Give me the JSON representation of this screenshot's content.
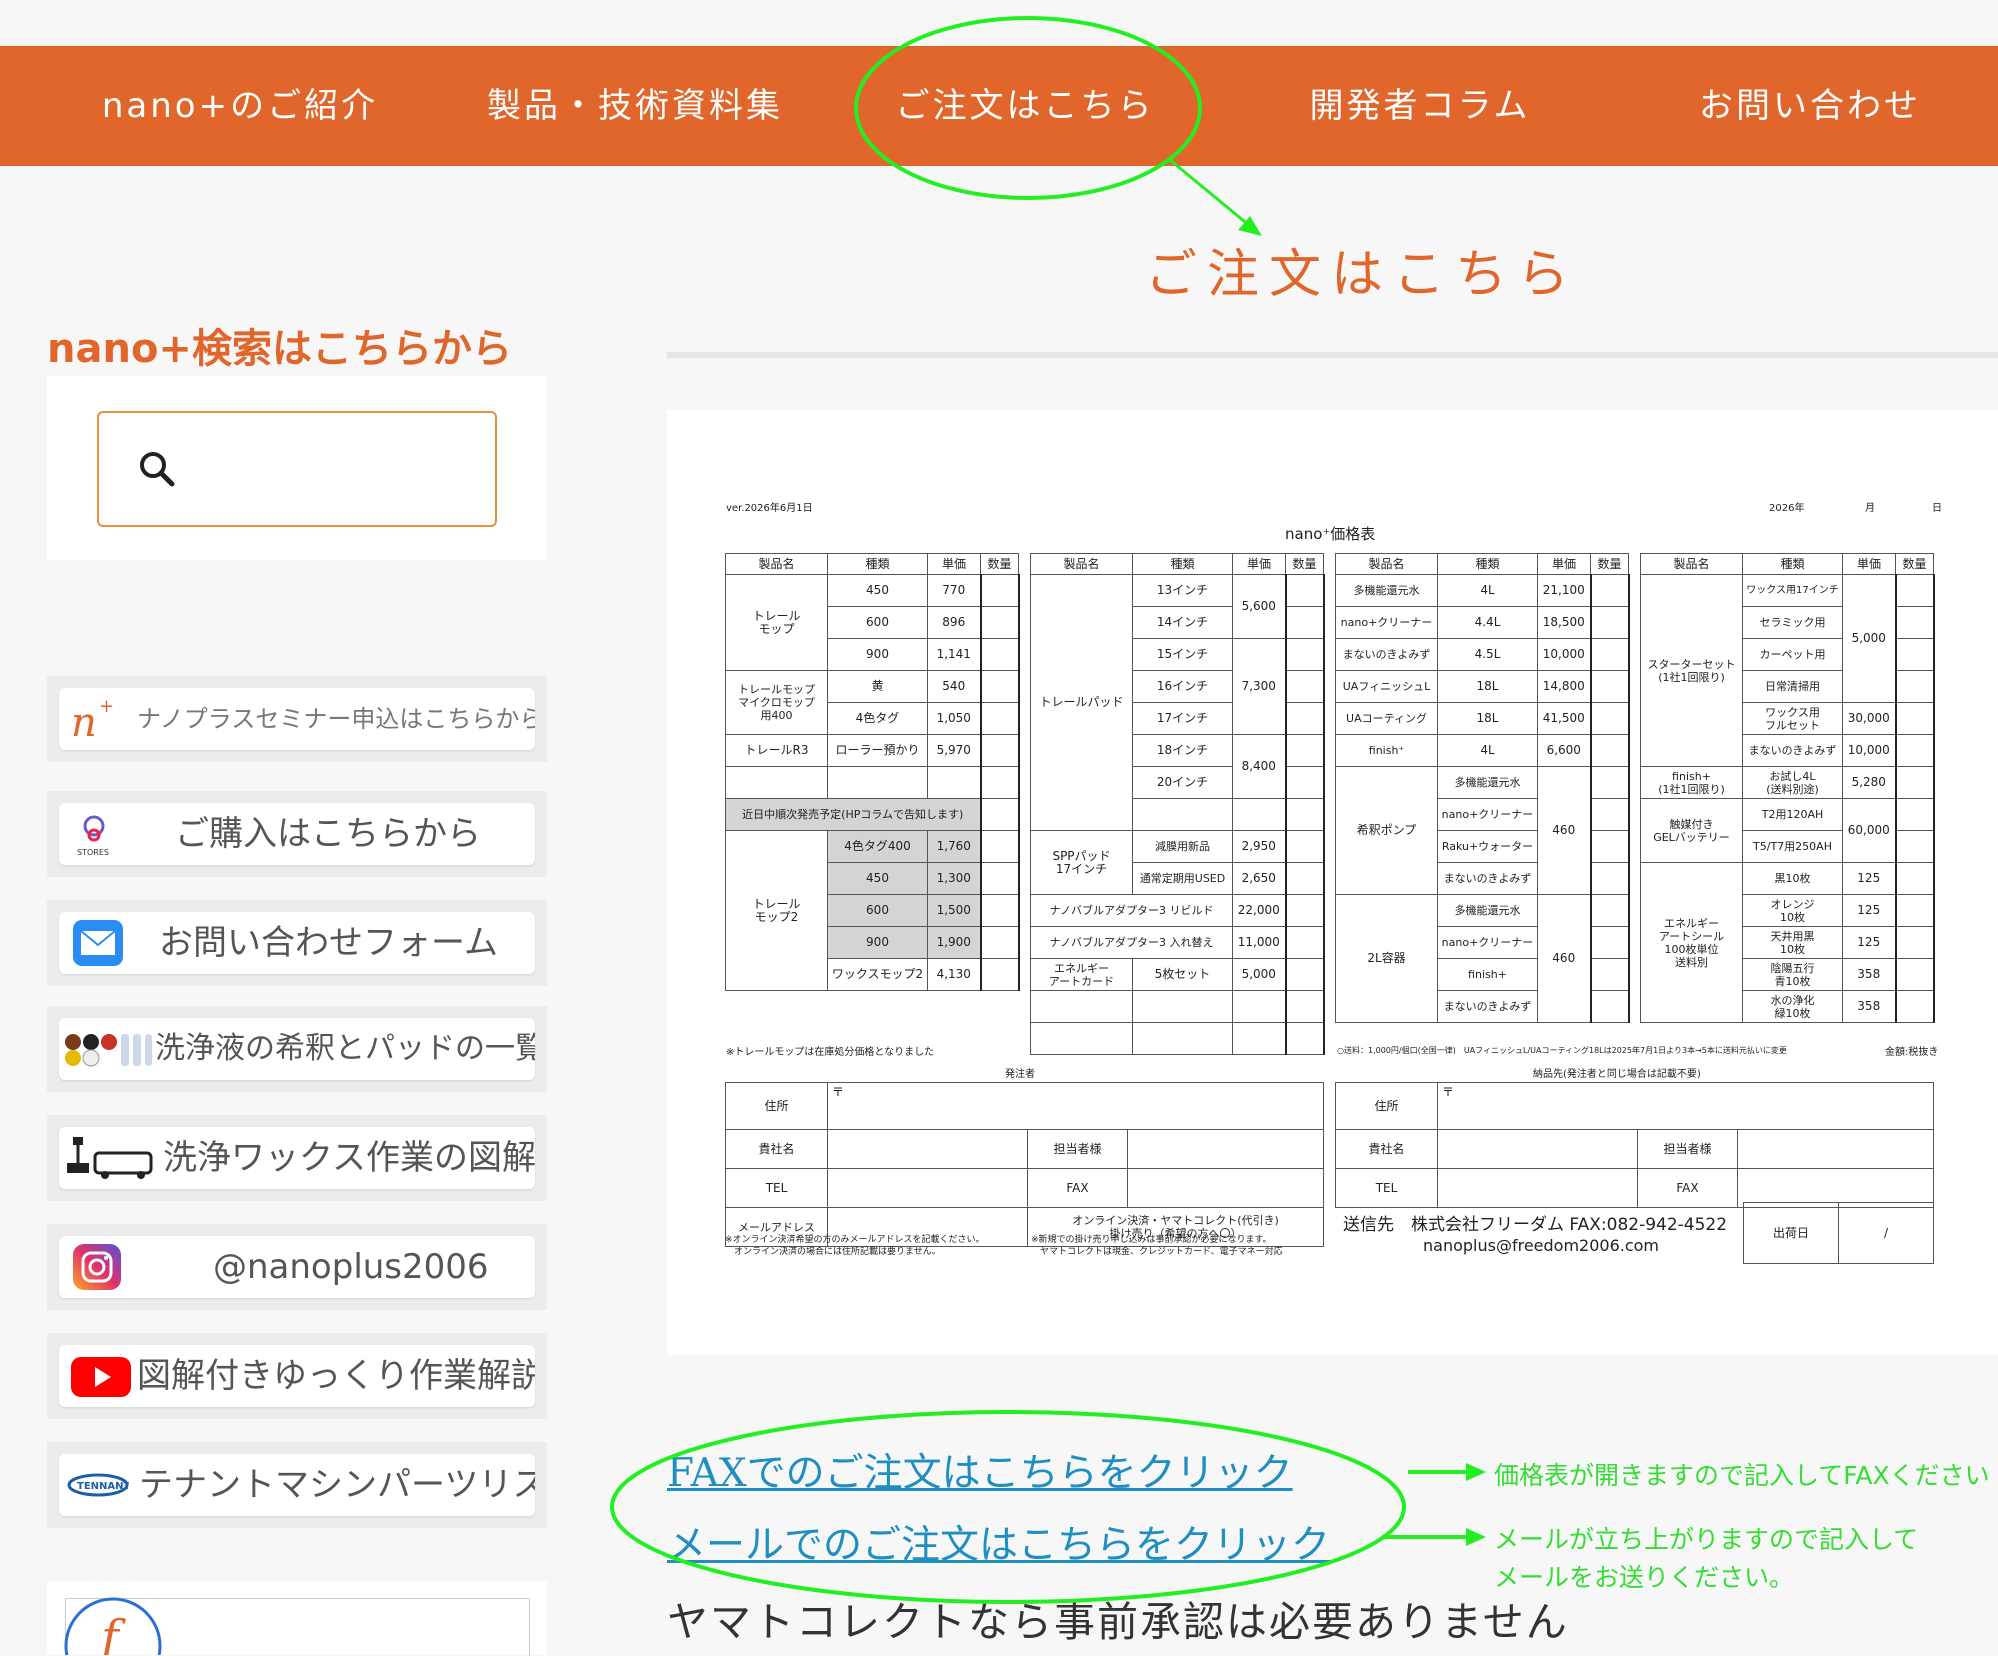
{
  "nav": [
    "nano+のご紹介",
    "製品・技術資料集",
    "ご注文はこちら",
    "開発者コラム",
    "お問い合わせ"
  ],
  "page_heading": "ご注文はこちら",
  "sidebar": {
    "search_title": "nano+検索はこちらから",
    "banners": [
      {
        "label": "ナノプラスセミナー申込はこちらから",
        "icon": "nanoplus-logo-icon"
      },
      {
        "label": "ご購入はこちらから",
        "icon": "stores-icon",
        "icon_caption": "STORES"
      },
      {
        "label": "お問い合わせフォーム",
        "icon": "mail-icon"
      },
      {
        "label": "洗浄液の希釈とパッドの一覧",
        "icon": "pads-bottles-icon"
      },
      {
        "label": "洗浄ワックス作業の図解",
        "icon": "floor-machine-icon"
      },
      {
        "label": "@nanoplus2006",
        "icon": "instagram-icon"
      },
      {
        "label": "図解付きゆっくり作業解説",
        "icon": "youtube-icon"
      },
      {
        "label": "テナントマシンパーツリスト",
        "icon": "tennant-icon",
        "icon_caption": "TENNANT"
      }
    ]
  },
  "sheet": {
    "version": "ver.2026年6月1日",
    "date_year": "2026年",
    "date_month": "月",
    "date_day": "日",
    "title": "nano⁺価格表",
    "headers": [
      "製品名",
      "種類",
      "単価",
      "数量"
    ],
    "t1": {
      "trail_mop": "トレール\nモップ",
      "rows_a": [
        [
          "450",
          "770"
        ],
        [
          "600",
          "896"
        ],
        [
          "900",
          "1,141"
        ]
      ],
      "micro": "トレールモップ\nマイクロモップ\n用400",
      "micro_rows": [
        [
          "黄",
          "540"
        ],
        [
          "4色タグ",
          "1,050"
        ]
      ],
      "r3": [
        "トレールR3",
        "ローラー預かり",
        "5,970"
      ],
      "notice": "近日中順次発売予定(HPコラムで告知します)",
      "mop2": "トレール\nモップ2",
      "mop2_rows": [
        [
          "4色タグ400",
          "1,760"
        ],
        [
          "450",
          "1,300"
        ],
        [
          "600",
          "1,500"
        ],
        [
          "900",
          "1,900"
        ],
        [
          "ワックスモップ2",
          "4,130"
        ]
      ]
    },
    "t2": {
      "trail_pad": "トレールパッド",
      "pad_sizes": [
        "13インチ",
        "14インチ",
        "15インチ",
        "16インチ",
        "17インチ",
        "18インチ",
        "20インチ"
      ],
      "pad_prices": [
        "5,600",
        "7,300",
        "8,400"
      ],
      "spp": "SPPパッド\n17インチ",
      "spp_rows": [
        [
          "減膜用新品",
          "2,950"
        ],
        [
          "通常定期用USED",
          "2,650"
        ]
      ],
      "adapter_rows": [
        [
          "ナノバブルアダプター3 リビルド",
          "22,000"
        ],
        [
          "ナノバブルアダプター3 入れ替え",
          "11,000"
        ]
      ],
      "energy": [
        "エネルギー\nアートカード",
        "5枚セット",
        "5,000"
      ]
    },
    "t3": {
      "rows": [
        [
          "多機能還元水",
          "4L",
          "21,100"
        ],
        [
          "nano+クリーナー",
          "4.4L",
          "18,500"
        ],
        [
          "まないのきよみず",
          "4.5L",
          "10,000"
        ],
        [
          "UAフィニッシュL",
          "18L",
          "14,800"
        ],
        [
          "UAコーティング",
          "18L",
          "41,500"
        ],
        [
          "finish⁺",
          "4L",
          "6,600"
        ]
      ],
      "pump": "希釈ポンプ",
      "pump_items": [
        "多機能還元水",
        "nano+クリーナー",
        "Raku+ウォーター",
        "まないのきよみず"
      ],
      "pump_price": "460",
      "container": "2L容器",
      "container_items": [
        "多機能還元水",
        "nano+クリーナー",
        "finish+",
        "まないのきよみず"
      ],
      "container_price": "460"
    },
    "t4": {
      "starter": "スターターセット\n(1社1回限り)",
      "starter_items": [
        "ワックス用17インチ",
        "セラミック用",
        "カーペット用",
        "日常清掃用"
      ],
      "starter_price": "5,000",
      "wax_full": [
        "ワックス用\nフルセット",
        "30,000"
      ],
      "manai": [
        "まないのきよみず",
        "10,000"
      ],
      "finish_trial": [
        "finish+\n(1社1回限り)",
        "お試し4L\n(送料別途)",
        "5,280"
      ],
      "gel": "触媒付き\nGELバッテリー",
      "gel_items": [
        "T2用120AH",
        "T5/T7用250AH"
      ],
      "gel_price": "60,000",
      "seal": "エネルギー\nアートシール\n100枚単位\n送料別",
      "seal_rows": [
        [
          "黒10枚",
          "125"
        ],
        [
          "オレンジ\n10枚",
          "125"
        ],
        [
          "天井用黒\n10枚",
          "125"
        ],
        [
          "陰陽五行\n青10枚",
          "358"
        ],
        [
          "水の浄化\n緑10枚",
          "358"
        ]
      ]
    },
    "note_left": "※トレールモップは在庫処分価格となりました",
    "note_mid": "○送料：1,000円/個口(全国一律)　UAフィニッシュL/UAコーティング18Lは2025年7月1日より3本→5本に送料元払いに変更",
    "note_right": "金額:税抜き",
    "orderer": "発注者",
    "delivery": "納品先(発注者と同じ場合は記載不要)",
    "f_address": "住所",
    "postal": "〒",
    "f_company": "貴社名",
    "f_person": "担当者様",
    "f_tel": "TEL",
    "f_fax": "FAX",
    "f_mail": "メールアドレス",
    "f_payment": "オンライン決済・ヤマトコレクト(代引き)\n掛け売り（希望の方へ〇）",
    "foot1": "※オンライン決済希望の方のみメールアドレスを記載ください。\n　オンライン決済の場合には住所記載は要りません。",
    "foot2": "※新規での掛け売り申し込みは事前承認が必要になります。\n　ヤマトコレクトは現金、クレジットカード、電子マネー対応",
    "send_to": "送信先　株式会社フリーダム  FAX:082-942-4522",
    "email": "nanoplus@freedom2006.com",
    "ship_date": "出荷日",
    "slash": "/"
  },
  "links": {
    "fax": "FAXでのご注文はこちらをクリック",
    "mail": "メールでのご注文はこちらをクリック",
    "yamato": "ヤマトコレクトなら事前承認は必要ありません"
  },
  "annotations": {
    "fax_note": "価格表が開きますので記入してFAXください",
    "mail_note1": "メールが立ち上がりますので記入して",
    "mail_note2": "メールをお送りください。"
  },
  "colors": {
    "accent": "#e0662b",
    "annotation": "#22ee22",
    "link": "#1f8ec0"
  }
}
